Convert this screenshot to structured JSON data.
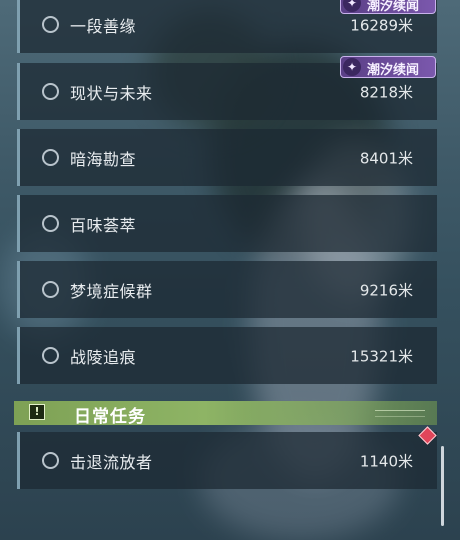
{
  "quests": [
    {
      "name": "一段善缘",
      "distance": "16289米"
    },
    {
      "name": "现状与未来",
      "distance": "8218米"
    },
    {
      "name": "暗海勘查",
      "distance": "8401米"
    },
    {
      "name": "百味荟萃",
      "distance": ""
    },
    {
      "name": "梦境症候群",
      "distance": "9216米"
    },
    {
      "name": "战陵追痕",
      "distance": "15321米"
    }
  ],
  "tags": [
    {
      "label": "潮汐续闻",
      "icon": "wave-icon"
    },
    {
      "label": "潮汐续闻",
      "icon": "wave-icon"
    }
  ],
  "daily": {
    "section_title": "日常任务",
    "section_icon": "exclamation-icon",
    "quests": [
      {
        "name": "击退流放者",
        "distance": "1140米"
      }
    ]
  },
  "colors": {
    "quest_panel": "#1c2832",
    "quest_accent": "#7fa0b0",
    "tag_purple": "#6a4c9c",
    "daily_green": "#8eb465",
    "marker_red": "#e0455a"
  }
}
